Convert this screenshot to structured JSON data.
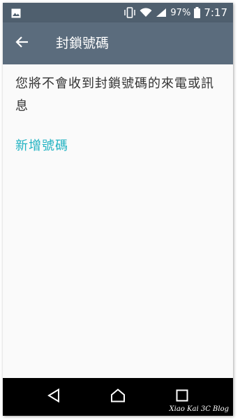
{
  "status_bar": {
    "left_icon": "image-icon",
    "icons": [
      "vibrate-icon",
      "wifi-icon",
      "signal-icon"
    ],
    "battery_percent": "97%",
    "time": "7:17"
  },
  "app_bar": {
    "back_icon": "back-arrow-icon",
    "title": "封鎖號碼"
  },
  "content": {
    "message": "您將不會收到封鎖號碼的來電或訊息",
    "add_number_label": "新增號碼"
  },
  "nav_bar": {
    "buttons": [
      "back-triangle-icon",
      "home-icon",
      "recents-icon"
    ]
  },
  "watermark": "Xiao Kai 3C Blog",
  "colors": {
    "status_bar": "#4f5f6e",
    "app_bar": "#5b6c7d",
    "accent": "#22b3c2",
    "background": "#fafafa"
  }
}
